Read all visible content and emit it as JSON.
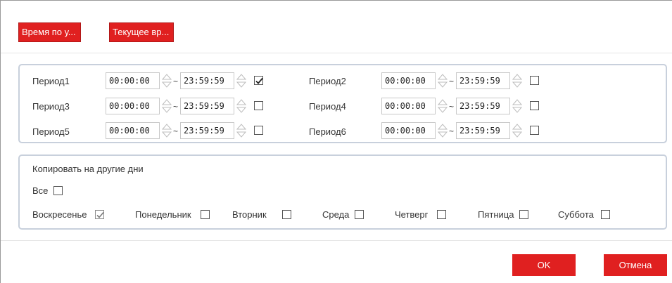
{
  "top_buttons": {
    "schedule_label": "Время по у...",
    "current_time_label": "Текущее вр..."
  },
  "periods": [
    {
      "label": "Период1",
      "start": "00:00:00",
      "end": "23:59:59",
      "checked": true
    },
    {
      "label": "Период2",
      "start": "00:00:00",
      "end": "23:59:59",
      "checked": false
    },
    {
      "label": "Период3",
      "start": "00:00:00",
      "end": "23:59:59",
      "checked": false
    },
    {
      "label": "Период4",
      "start": "00:00:00",
      "end": "23:59:59",
      "checked": false
    },
    {
      "label": "Период5",
      "start": "00:00:00",
      "end": "23:59:59",
      "checked": false
    },
    {
      "label": "Период6",
      "start": "00:00:00",
      "end": "23:59:59",
      "checked": false
    }
  ],
  "range_separator": "~",
  "copy": {
    "title": "Копировать на другие дни",
    "all_label": "Все",
    "all_checked": false,
    "days": [
      {
        "label": "Воскресенье",
        "checked": true,
        "disabled": true
      },
      {
        "label": "Понедельник",
        "checked": false
      },
      {
        "label": "Вторник",
        "checked": false
      },
      {
        "label": "Среда",
        "checked": false
      },
      {
        "label": "Четверг",
        "checked": false
      },
      {
        "label": "Пятница",
        "checked": false
      },
      {
        "label": "Суббота",
        "checked": false
      }
    ]
  },
  "footer": {
    "ok_label": "OK",
    "cancel_label": "Отмена"
  },
  "colors": {
    "accent": "#e02020",
    "box_border": "#c8d0dc"
  },
  "icons": {
    "spinner": "up-down-arrow-icon",
    "check": "checkmark-icon"
  }
}
